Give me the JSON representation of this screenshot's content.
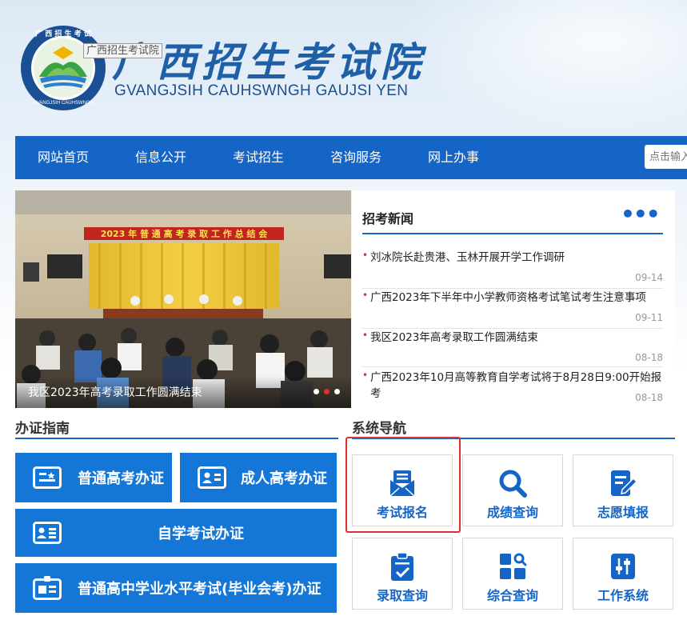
{
  "header": {
    "title_cn": "广西招生考试院",
    "title_en": "GVANGJSIH CAUHSWNGH GAUJSI YEN",
    "tooltip": "广西招生考试院",
    "logo_text": "GVANGJSIH CAUHSWNGH GAUJSI YEN"
  },
  "nav": {
    "items": [
      "网站首页",
      "信息公开",
      "考试招生",
      "咨询服务",
      "网上办事"
    ],
    "search_placeholder": "点击输入"
  },
  "banner": {
    "stage_banner": "2023年普通高考录取工作总结会",
    "caption": "我区2023年高考录取工作圆满结束"
  },
  "news": {
    "title": "招考新闻",
    "more": "•••",
    "items": [
      {
        "text": "刘冰院长赴贵港、玉林开展开学工作调研",
        "date": "09-14"
      },
      {
        "text": "广西2023年下半年中小学教师资格考试笔试考生注意事项",
        "date": "09-11"
      },
      {
        "text": "我区2023年高考录取工作圆满结束",
        "date": "08-18"
      },
      {
        "text": "广西2023年10月高等教育自学考试将于8月28日9:00开始报考",
        "date": "08-18"
      }
    ]
  },
  "guide": {
    "title": "办证指南",
    "buttons": [
      "普通高考办证",
      "成人高考办证",
      "自学考试办证",
      "普通高中学业水平考试(毕业会考)办证"
    ]
  },
  "system": {
    "title": "系统导航",
    "tiles": [
      {
        "label": "考试报名",
        "icon": "registration-icon"
      },
      {
        "label": "成绩查询",
        "icon": "search-icon"
      },
      {
        "label": "志愿填报",
        "icon": "edit-form-icon"
      },
      {
        "label": "录取查询",
        "icon": "clipboard-check-icon"
      },
      {
        "label": "综合查询",
        "icon": "grid-search-icon"
      },
      {
        "label": "工作系统",
        "icon": "sliders-icon"
      }
    ]
  },
  "colors": {
    "primary": "#1565c7",
    "button": "#1476d6",
    "accent": "#e0302f"
  }
}
